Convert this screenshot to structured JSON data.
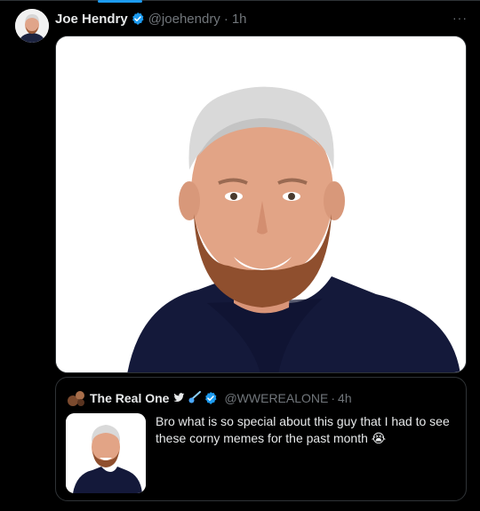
{
  "colors": {
    "accent": "#1d9bf0",
    "background": "#000000",
    "muted": "#71767b",
    "text": "#e7e9ea"
  },
  "tweet": {
    "author_name": "Joe Hendry",
    "author_handle": "@joehendry",
    "separator": "·",
    "time": "1h",
    "more_icon": "more-dots-icon",
    "more_label": "···",
    "media_alt": "Photo of Joe Hendry"
  },
  "quote": {
    "author_name": "The Real One",
    "author_handle": "@WWEREALONE",
    "separator": "·",
    "time": "4h",
    "text": "Bro what is so special about this guy that  I had to see these corny memes for the past month 😭"
  }
}
